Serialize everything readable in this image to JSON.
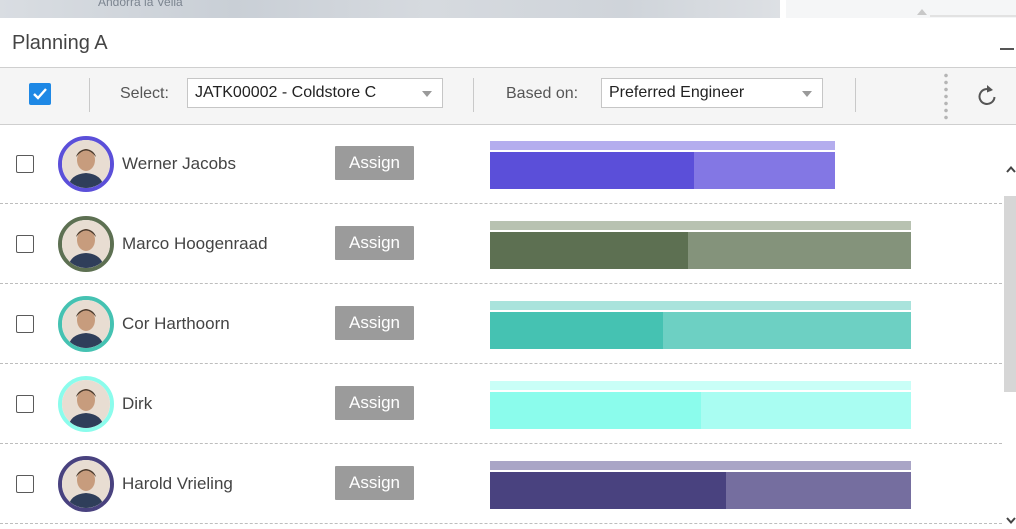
{
  "map": {
    "label": "Andorra la Vella"
  },
  "panel": {
    "title": "Planning A"
  },
  "toolbar": {
    "select_label": "Select:",
    "select_value": "JATK00002 - Coldstore C",
    "based_label": "Based on:",
    "based_value": "Preferred Engineer"
  },
  "engineers": [
    {
      "name": "Werner Jacobs",
      "assign": "Assign",
      "color": "#5b4fd9",
      "light": "#8377e4",
      "top": "#b4adee",
      "fill": 0.59,
      "bar_width_fraction": 0.82
    },
    {
      "name": "Marco Hoogenraad",
      "assign": "Assign",
      "color": "#5d7052",
      "light": "#84937b",
      "top": "#b8c2b1",
      "fill": 0.47,
      "bar_width_fraction": 1.0
    },
    {
      "name": "Cor Harthoorn",
      "assign": "Assign",
      "color": "#45c2b2",
      "light": "#6dd0c3",
      "top": "#a9e3dc",
      "fill": 0.41,
      "bar_width_fraction": 1.0
    },
    {
      "name": "Dirk",
      "assign": "Assign",
      "color": "#8bfcec",
      "light": "#a9fdf2",
      "top": "#c9fef7",
      "fill": 0.5,
      "bar_width_fraction": 1.0
    },
    {
      "name": "Harold Vrieling",
      "assign": "Assign",
      "color": "#49427f",
      "light": "#756e9f",
      "top": "#a9a5c6",
      "fill": 0.56,
      "bar_width_fraction": 1.0
    }
  ]
}
